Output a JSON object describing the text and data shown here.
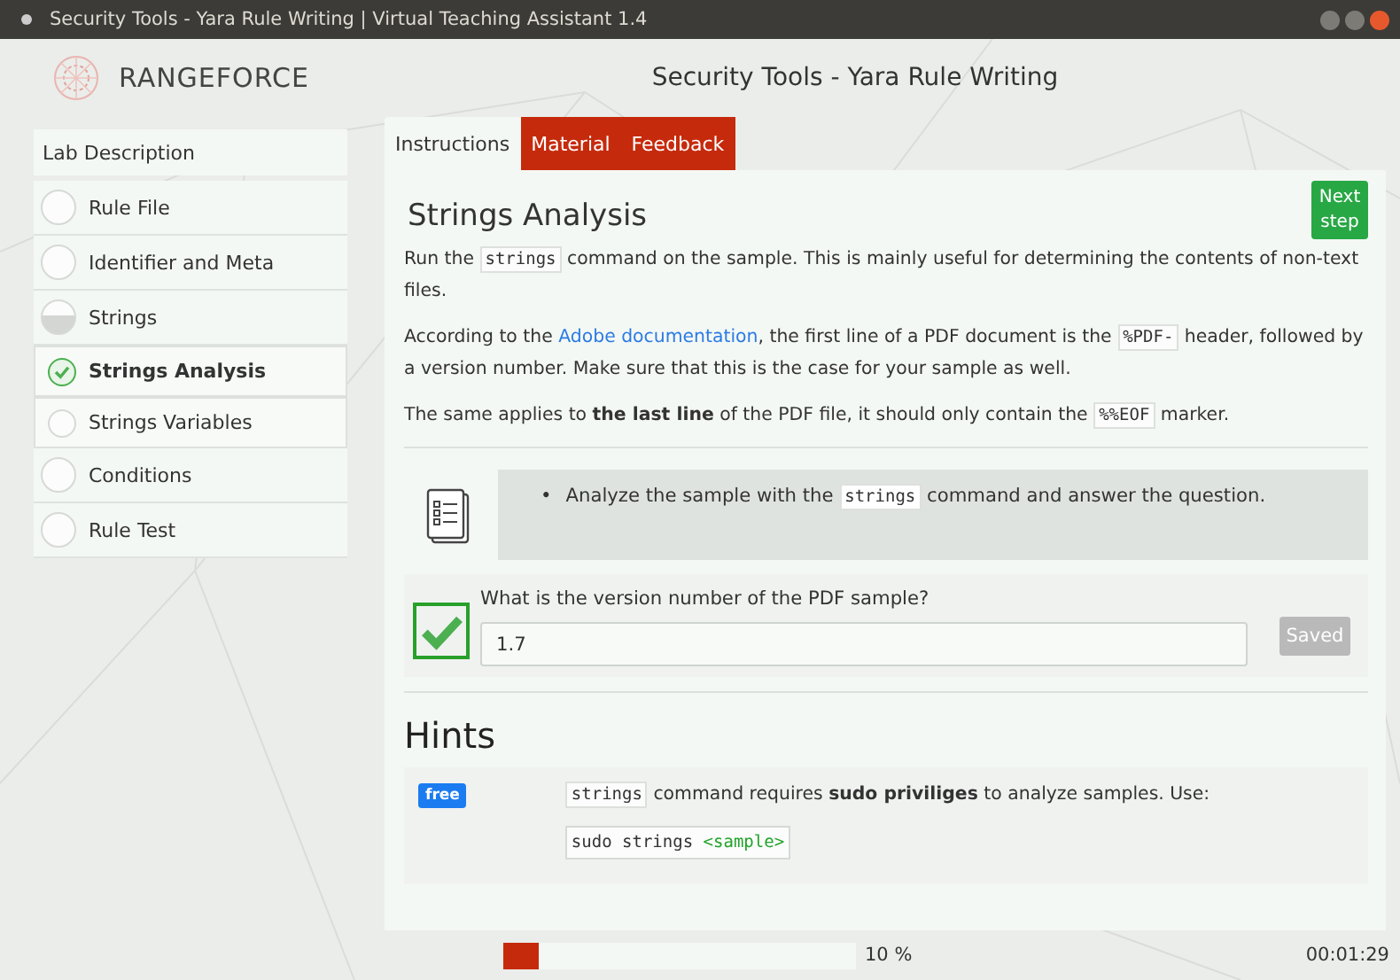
{
  "window": {
    "title": "Security Tools - Yara Rule Writing | Virtual Teaching Assistant 1.4"
  },
  "header": {
    "brand": "RANGEFORCE",
    "title": "Security Tools - Yara Rule Writing"
  },
  "sidebar": {
    "items": [
      {
        "label": "Lab Description",
        "kind": "heading",
        "selected": false
      },
      {
        "label": "Rule File",
        "kind": "step",
        "started": false,
        "completed": false,
        "selected": false
      },
      {
        "label": "Identifier and Meta",
        "kind": "step",
        "started": false,
        "completed": false,
        "selected": false
      },
      {
        "label": "Strings",
        "kind": "step",
        "started": true,
        "completed": false,
        "selected": false,
        "children": [
          {
            "label": "Strings Analysis",
            "completed": true,
            "selected": true
          },
          {
            "label": "Strings Variables",
            "completed": false,
            "selected": false
          }
        ]
      },
      {
        "label": "Conditions",
        "kind": "step",
        "started": false,
        "completed": false,
        "selected": false
      },
      {
        "label": "Rule Test",
        "kind": "step",
        "started": false,
        "completed": false,
        "selected": false
      }
    ]
  },
  "tabs": [
    {
      "label": "Instructions",
      "selected": true
    },
    {
      "label": "Material",
      "selected": false
    },
    {
      "label": "Feedback",
      "selected": false
    }
  ],
  "content": {
    "title": "Strings Analysis",
    "next_button": "Next step",
    "paragraphs": [
      [
        {
          "kind": "text",
          "text": "Run the "
        },
        {
          "kind": "code",
          "text": "strings"
        },
        {
          "kind": "text",
          "text": " command on the sample. This is mainly useful for determining the contents of non-text files."
        }
      ],
      [
        {
          "kind": "text",
          "text": "According to the "
        },
        {
          "kind": "link",
          "text": "Adobe documentation"
        },
        {
          "kind": "text",
          "text": ", the first line of a PDF document is the "
        },
        {
          "kind": "code",
          "text": "%PDF-"
        },
        {
          "kind": "text",
          "text": " header, followed by a version number. Make sure that this is the case for your sample as well."
        }
      ],
      [
        {
          "kind": "text",
          "text": "The same applies to **the last line** of the PDF file, it should only contain the "
        },
        {
          "kind": "code",
          "text": "%%EOF"
        },
        {
          "kind": "text",
          "text": " marker."
        }
      ]
    ],
    "task_bullet": "•",
    "task": [
      {
        "kind": "text",
        "text": "Analyze the sample with the "
      },
      {
        "kind": "code",
        "text": "strings"
      },
      {
        "kind": "text",
        "text": " command and answer the question."
      }
    ],
    "question": {
      "label": "What is the version number of the PDF sample?",
      "value": "1.7",
      "correct": true,
      "button": "Saved",
      "button_disabled": true
    },
    "hints_title": "Hints",
    "hints": [
      {
        "badge": "free",
        "text": [
          {
            "kind": "code",
            "text": "strings"
          },
          {
            "kind": "text",
            "text": " command requires **sudo priviliges** to analyze samples. Use:"
          }
        ],
        "command": "sudo strings ",
        "command_arg": "<sample>"
      }
    ]
  },
  "status_bar": {
    "progress": {
      "level": 0.1,
      "reading": "10 %"
    },
    "timer": "00:01:29"
  }
}
